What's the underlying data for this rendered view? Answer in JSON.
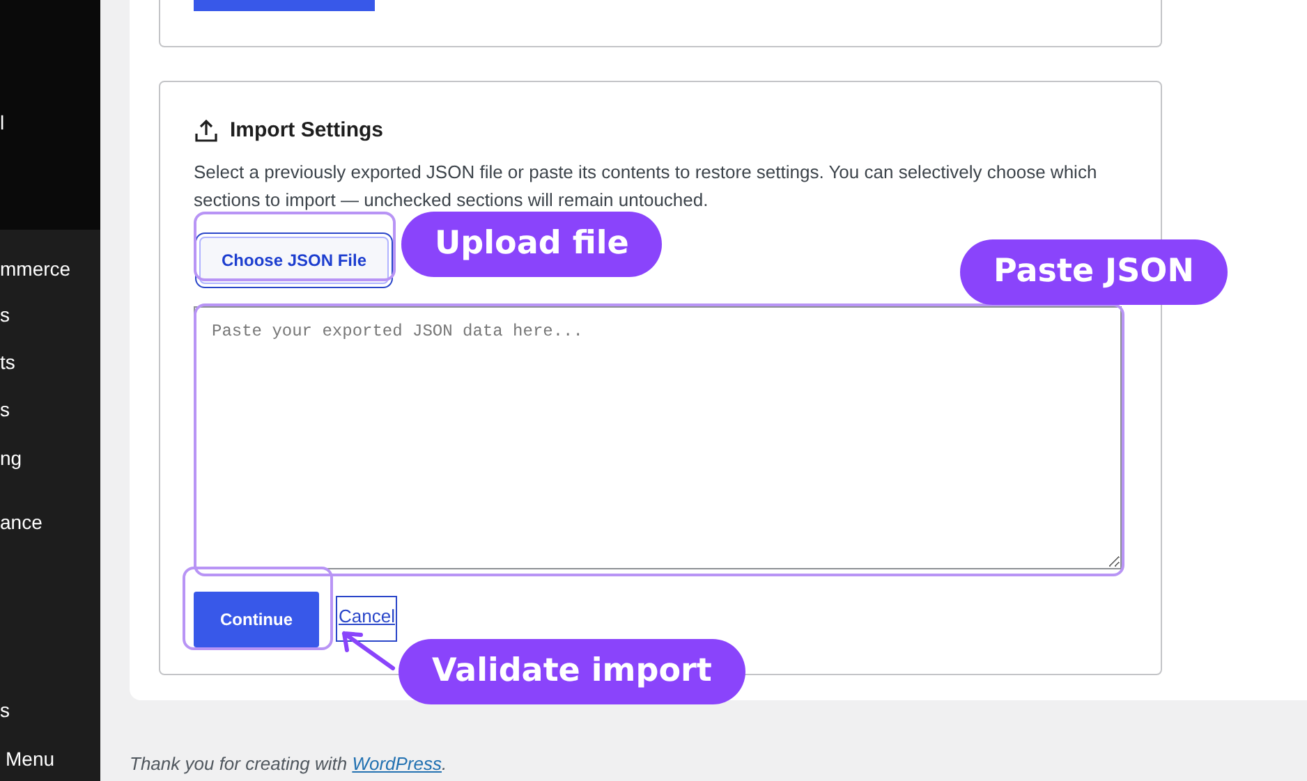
{
  "sidebar": {
    "items": [
      {
        "label": "l",
        "selected": false
      },
      {
        "label": "mmerce",
        "selected": false
      },
      {
        "label": "s",
        "selected": false
      },
      {
        "label": "ts",
        "selected": false
      },
      {
        "label": "s",
        "selected": false
      },
      {
        "label": "ng",
        "selected": false
      },
      {
        "label": "ance",
        "selected": false
      },
      {
        "label": "s",
        "selected": false
      },
      {
        "label": "Menu",
        "selected": false
      }
    ]
  },
  "import_card": {
    "title": "Import Settings",
    "description": "Select a previously exported JSON file or paste its contents to restore settings. You can selectively choose which sections to import — unchecked sections will remain untouched.",
    "file_button": "Choose JSON File",
    "textarea": {
      "placeholder": "Paste your exported JSON data here..."
    },
    "continue_button": "Continue",
    "cancel_link": "Cancel"
  },
  "annotations": [
    {
      "label": "Upload file"
    },
    {
      "label": "Paste JSON"
    },
    {
      "label": "Validate import",
      "kind": "arrow"
    }
  ],
  "footer": {
    "text": "Thank you for creating with ",
    "link": "WordPress",
    "suffix": "."
  }
}
